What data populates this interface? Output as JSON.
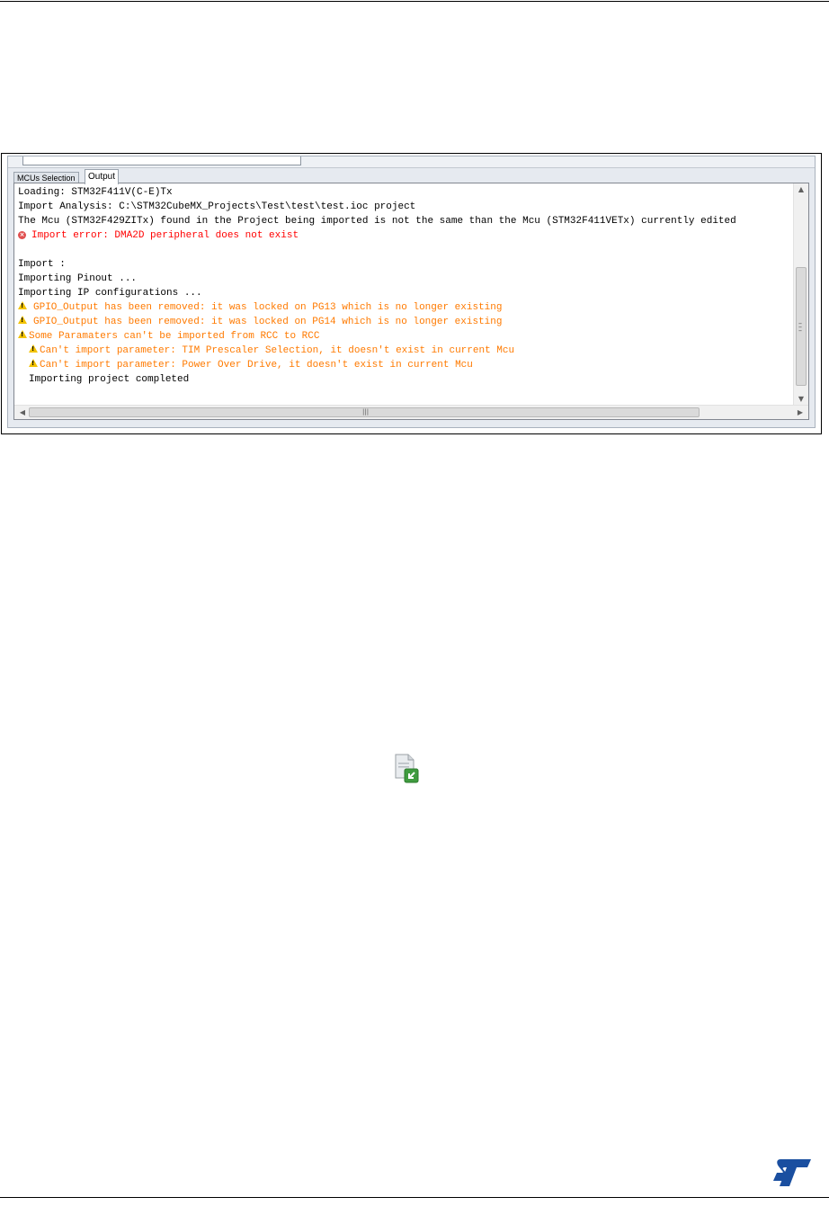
{
  "window": {
    "tabs": [
      {
        "label": "MCUs Selection",
        "active": false
      },
      {
        "label": "Output",
        "active": true
      }
    ]
  },
  "output": {
    "lines": [
      {
        "text": "Loading: STM32F411V(C-E)Tx",
        "kind": "normal"
      },
      {
        "text": "Import Analysis: C:\\STM32CubeMX_Projects\\Test\\test\\test.ioc project",
        "kind": "normal"
      },
      {
        "text": "The Mcu (STM32F429ZITx) found in the Project being imported is not the same than the Mcu (STM32F411VETx) currently edited",
        "kind": "normal"
      },
      {
        "text": "Import error: DMA2D peripheral does not exist",
        "kind": "error",
        "icon": "error-icon"
      },
      {
        "text": "",
        "kind": "normal"
      },
      {
        "text": "Import :",
        "kind": "normal"
      },
      {
        "text": "Importing Pinout ...",
        "kind": "normal"
      },
      {
        "text": "Importing IP configurations ...",
        "kind": "normal"
      },
      {
        "text": "GPIO_Output has been removed: it was locked on PG13 which is no longer existing",
        "kind": "warning",
        "icon": "warning-icon"
      },
      {
        "text": "GPIO_Output has been removed: it was locked on PG14 which is no longer existing",
        "kind": "warning",
        "icon": "warning-icon"
      },
      {
        "text": "Some Paramaters can't be imported from RCC to RCC",
        "kind": "warning",
        "icon": "warning-icon"
      },
      {
        "text": "Can't import parameter: TIM Prescaler Selection, it doesn't exist in current Mcu",
        "kind": "warning",
        "icon": "warning-icon",
        "indent": true
      },
      {
        "text": "Can't import parameter: Power Over Drive, it doesn't exist in current Mcu",
        "kind": "warning",
        "icon": "warning-icon",
        "indent": true
      },
      {
        "text": "Importing project completed",
        "kind": "normal",
        "indent": true
      }
    ]
  },
  "colors": {
    "error": "#ff0000",
    "warning": "#ff7a00",
    "normal": "#000000",
    "logo": "#1a4fa0"
  },
  "icons": {
    "import_icon": "import-file-icon",
    "logo": "st-logo"
  }
}
